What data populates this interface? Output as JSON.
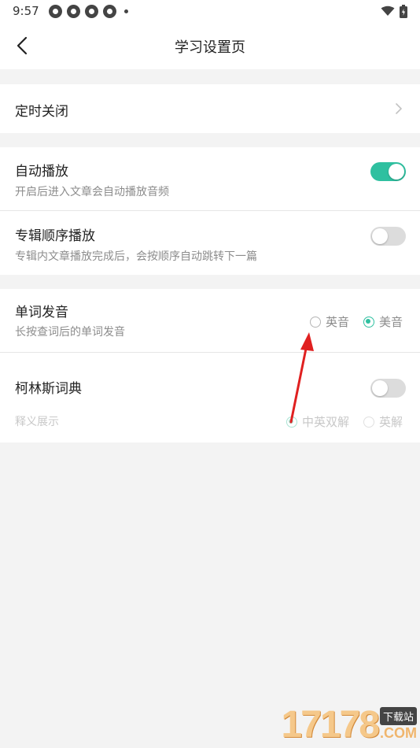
{
  "status_bar": {
    "time": "9:57",
    "icons": [
      "app-icon",
      "app-icon",
      "app-icon",
      "app-icon"
    ],
    "right_icons": [
      "wifi-icon",
      "battery-icon"
    ]
  },
  "header": {
    "title": "学习设置页",
    "back_icon": "chevron-left-icon"
  },
  "sections": {
    "timer": {
      "title": "定时关闭"
    },
    "autoplay": {
      "title": "自动播放",
      "subtitle": "开启后进入文章会自动播放音频",
      "enabled": true
    },
    "album_order": {
      "title": "专辑顺序播放",
      "subtitle": "专辑内文章播放完成后，会按顺序自动跳转下一篇",
      "enabled": false
    },
    "pronunciation": {
      "title": "单词发音",
      "subtitle": "长按查词后的单词发音",
      "options": [
        "英音",
        "美音"
      ],
      "selected": "美音"
    },
    "collins": {
      "title": "柯林斯词典",
      "enabled": false,
      "display_label": "释义展示",
      "options": [
        "中英双解",
        "英解"
      ],
      "selected": "中英双解"
    }
  },
  "colors": {
    "accent": "#2fc0a0",
    "annotation_arrow": "#e02020"
  },
  "watermark": {
    "digits": "17178",
    "badge": "下载站",
    "suffix": ".COM"
  }
}
